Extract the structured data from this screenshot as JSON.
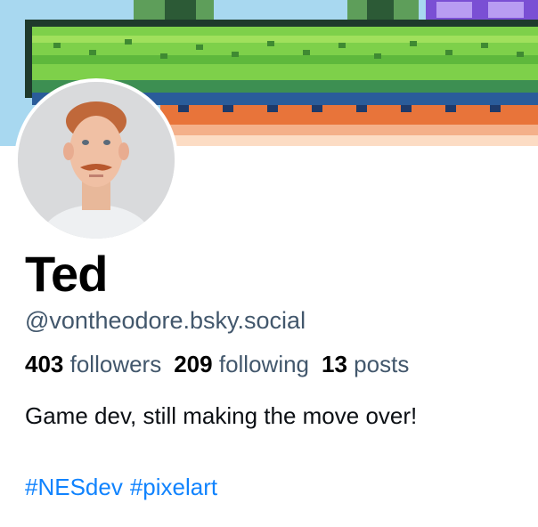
{
  "profile": {
    "display_name": "Ted",
    "handle": "@vontheodore.bsky.social",
    "bio": "Game dev, still making the move over!",
    "hashtags": [
      "#NESdev",
      "#pixelart"
    ]
  },
  "stats": {
    "followers": {
      "count": "403",
      "label": "followers"
    },
    "following": {
      "count": "209",
      "label": "following"
    },
    "posts": {
      "count": "13",
      "label": "posts"
    }
  },
  "colors": {
    "name": "#000000",
    "secondary_text": "#42576c",
    "link": "#1083fe",
    "banner_sky": "#a8d8f0",
    "banner_grass": "#7ed04a",
    "banner_dirt": "#e8743a"
  },
  "icons": {
    "banner": "pixel-art-landscape",
    "avatar": "user-photo"
  }
}
